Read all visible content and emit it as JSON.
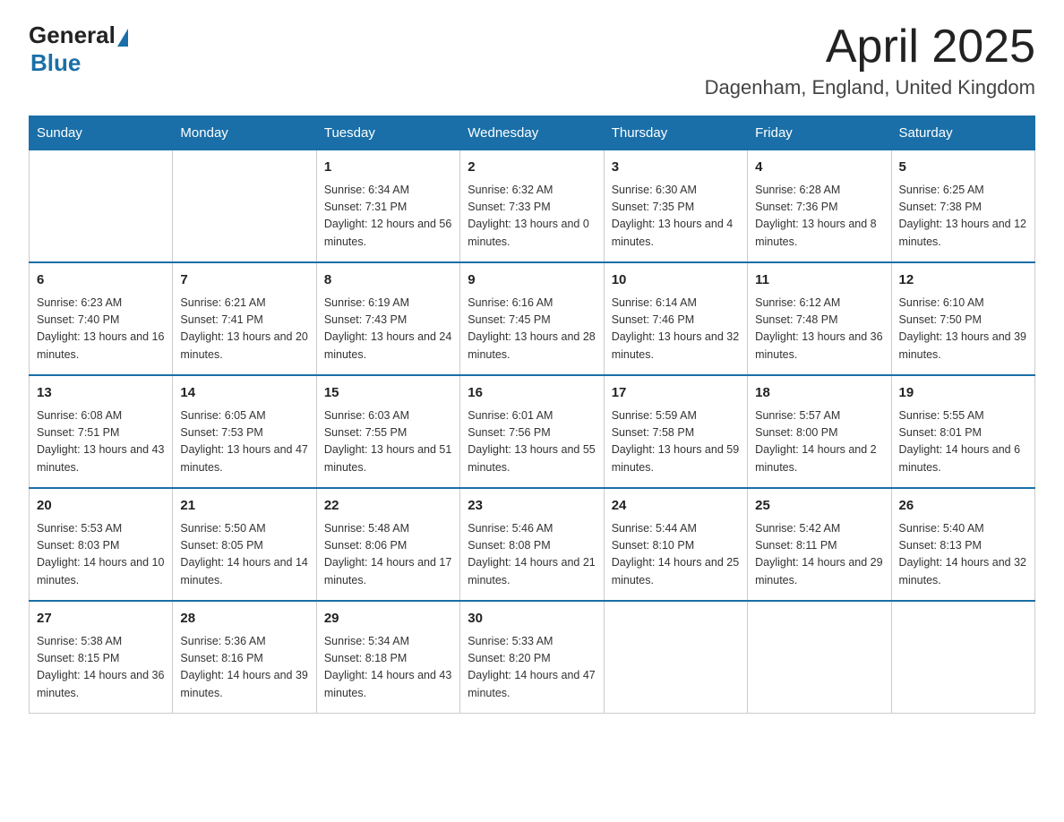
{
  "header": {
    "logo": {
      "text_general": "General",
      "text_blue": "Blue"
    },
    "title": "April 2025",
    "location": "Dagenham, England, United Kingdom"
  },
  "weekdays": [
    "Sunday",
    "Monday",
    "Tuesday",
    "Wednesday",
    "Thursday",
    "Friday",
    "Saturday"
  ],
  "weeks": [
    [
      {
        "day": "",
        "sunrise": "",
        "sunset": "",
        "daylight": ""
      },
      {
        "day": "",
        "sunrise": "",
        "sunset": "",
        "daylight": ""
      },
      {
        "day": "1",
        "sunrise": "Sunrise: 6:34 AM",
        "sunset": "Sunset: 7:31 PM",
        "daylight": "Daylight: 12 hours and 56 minutes."
      },
      {
        "day": "2",
        "sunrise": "Sunrise: 6:32 AM",
        "sunset": "Sunset: 7:33 PM",
        "daylight": "Daylight: 13 hours and 0 minutes."
      },
      {
        "day": "3",
        "sunrise": "Sunrise: 6:30 AM",
        "sunset": "Sunset: 7:35 PM",
        "daylight": "Daylight: 13 hours and 4 minutes."
      },
      {
        "day": "4",
        "sunrise": "Sunrise: 6:28 AM",
        "sunset": "Sunset: 7:36 PM",
        "daylight": "Daylight: 13 hours and 8 minutes."
      },
      {
        "day": "5",
        "sunrise": "Sunrise: 6:25 AM",
        "sunset": "Sunset: 7:38 PM",
        "daylight": "Daylight: 13 hours and 12 minutes."
      }
    ],
    [
      {
        "day": "6",
        "sunrise": "Sunrise: 6:23 AM",
        "sunset": "Sunset: 7:40 PM",
        "daylight": "Daylight: 13 hours and 16 minutes."
      },
      {
        "day": "7",
        "sunrise": "Sunrise: 6:21 AM",
        "sunset": "Sunset: 7:41 PM",
        "daylight": "Daylight: 13 hours and 20 minutes."
      },
      {
        "day": "8",
        "sunrise": "Sunrise: 6:19 AM",
        "sunset": "Sunset: 7:43 PM",
        "daylight": "Daylight: 13 hours and 24 minutes."
      },
      {
        "day": "9",
        "sunrise": "Sunrise: 6:16 AM",
        "sunset": "Sunset: 7:45 PM",
        "daylight": "Daylight: 13 hours and 28 minutes."
      },
      {
        "day": "10",
        "sunrise": "Sunrise: 6:14 AM",
        "sunset": "Sunset: 7:46 PM",
        "daylight": "Daylight: 13 hours and 32 minutes."
      },
      {
        "day": "11",
        "sunrise": "Sunrise: 6:12 AM",
        "sunset": "Sunset: 7:48 PM",
        "daylight": "Daylight: 13 hours and 36 minutes."
      },
      {
        "day": "12",
        "sunrise": "Sunrise: 6:10 AM",
        "sunset": "Sunset: 7:50 PM",
        "daylight": "Daylight: 13 hours and 39 minutes."
      }
    ],
    [
      {
        "day": "13",
        "sunrise": "Sunrise: 6:08 AM",
        "sunset": "Sunset: 7:51 PM",
        "daylight": "Daylight: 13 hours and 43 minutes."
      },
      {
        "day": "14",
        "sunrise": "Sunrise: 6:05 AM",
        "sunset": "Sunset: 7:53 PM",
        "daylight": "Daylight: 13 hours and 47 minutes."
      },
      {
        "day": "15",
        "sunrise": "Sunrise: 6:03 AM",
        "sunset": "Sunset: 7:55 PM",
        "daylight": "Daylight: 13 hours and 51 minutes."
      },
      {
        "day": "16",
        "sunrise": "Sunrise: 6:01 AM",
        "sunset": "Sunset: 7:56 PM",
        "daylight": "Daylight: 13 hours and 55 minutes."
      },
      {
        "day": "17",
        "sunrise": "Sunrise: 5:59 AM",
        "sunset": "Sunset: 7:58 PM",
        "daylight": "Daylight: 13 hours and 59 minutes."
      },
      {
        "day": "18",
        "sunrise": "Sunrise: 5:57 AM",
        "sunset": "Sunset: 8:00 PM",
        "daylight": "Daylight: 14 hours and 2 minutes."
      },
      {
        "day": "19",
        "sunrise": "Sunrise: 5:55 AM",
        "sunset": "Sunset: 8:01 PM",
        "daylight": "Daylight: 14 hours and 6 minutes."
      }
    ],
    [
      {
        "day": "20",
        "sunrise": "Sunrise: 5:53 AM",
        "sunset": "Sunset: 8:03 PM",
        "daylight": "Daylight: 14 hours and 10 minutes."
      },
      {
        "day": "21",
        "sunrise": "Sunrise: 5:50 AM",
        "sunset": "Sunset: 8:05 PM",
        "daylight": "Daylight: 14 hours and 14 minutes."
      },
      {
        "day": "22",
        "sunrise": "Sunrise: 5:48 AM",
        "sunset": "Sunset: 8:06 PM",
        "daylight": "Daylight: 14 hours and 17 minutes."
      },
      {
        "day": "23",
        "sunrise": "Sunrise: 5:46 AM",
        "sunset": "Sunset: 8:08 PM",
        "daylight": "Daylight: 14 hours and 21 minutes."
      },
      {
        "day": "24",
        "sunrise": "Sunrise: 5:44 AM",
        "sunset": "Sunset: 8:10 PM",
        "daylight": "Daylight: 14 hours and 25 minutes."
      },
      {
        "day": "25",
        "sunrise": "Sunrise: 5:42 AM",
        "sunset": "Sunset: 8:11 PM",
        "daylight": "Daylight: 14 hours and 29 minutes."
      },
      {
        "day": "26",
        "sunrise": "Sunrise: 5:40 AM",
        "sunset": "Sunset: 8:13 PM",
        "daylight": "Daylight: 14 hours and 32 minutes."
      }
    ],
    [
      {
        "day": "27",
        "sunrise": "Sunrise: 5:38 AM",
        "sunset": "Sunset: 8:15 PM",
        "daylight": "Daylight: 14 hours and 36 minutes."
      },
      {
        "day": "28",
        "sunrise": "Sunrise: 5:36 AM",
        "sunset": "Sunset: 8:16 PM",
        "daylight": "Daylight: 14 hours and 39 minutes."
      },
      {
        "day": "29",
        "sunrise": "Sunrise: 5:34 AM",
        "sunset": "Sunset: 8:18 PM",
        "daylight": "Daylight: 14 hours and 43 minutes."
      },
      {
        "day": "30",
        "sunrise": "Sunrise: 5:33 AM",
        "sunset": "Sunset: 8:20 PM",
        "daylight": "Daylight: 14 hours and 47 minutes."
      },
      {
        "day": "",
        "sunrise": "",
        "sunset": "",
        "daylight": ""
      },
      {
        "day": "",
        "sunrise": "",
        "sunset": "",
        "daylight": ""
      },
      {
        "day": "",
        "sunrise": "",
        "sunset": "",
        "daylight": ""
      }
    ]
  ]
}
